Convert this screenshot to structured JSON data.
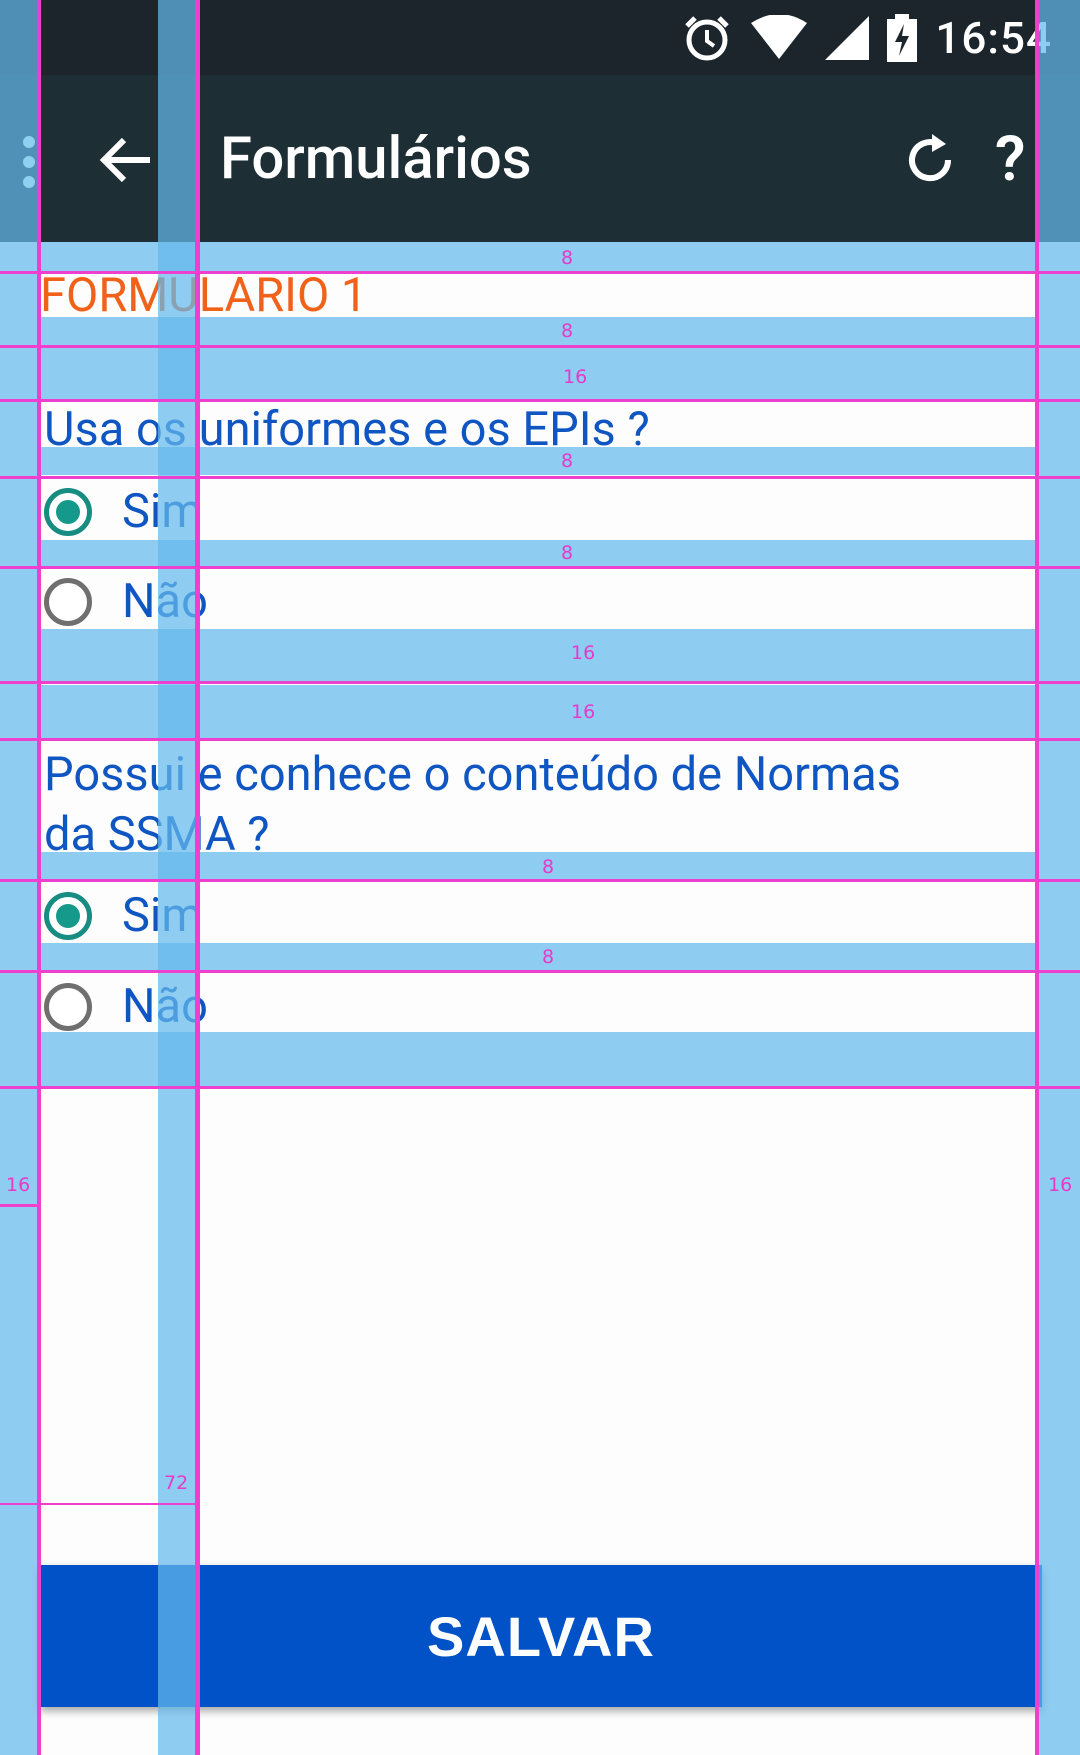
{
  "status_bar": {
    "time": "16:54"
  },
  "app_bar": {
    "title": "Formulários",
    "back_icon": "arrow-left",
    "refresh_icon": "refresh",
    "help_label": "?"
  },
  "form": {
    "title": "FORMULARIO 1",
    "questions": [
      {
        "text": "Usa os uniformes e os EPIs ?",
        "options": [
          {
            "label": "Sim",
            "selected": true
          },
          {
            "label": "Não",
            "selected": false
          }
        ]
      },
      {
        "text": "Possui e conhece o conteúdo de Normas da SSMA ?",
        "options": [
          {
            "label": "Sim",
            "selected": true
          },
          {
            "label": "Não",
            "selected": false
          }
        ]
      }
    ]
  },
  "save_button": {
    "label": "SALVAR"
  },
  "layout_bounds": {
    "labels": [
      "8",
      "8",
      "16",
      "8",
      "8",
      "16",
      "16",
      "8",
      "8",
      "16",
      "16",
      "72"
    ]
  },
  "colors": {
    "accent": "#0052c6",
    "title": "#f0611a",
    "text": "#0f56c2",
    "radio": "#14998b"
  }
}
